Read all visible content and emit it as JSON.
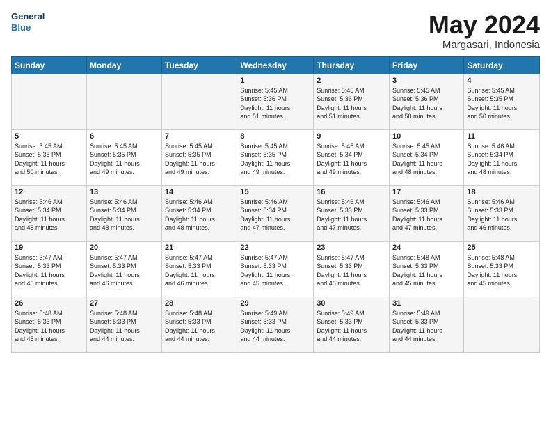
{
  "header": {
    "logo_line1": "General",
    "logo_line2": "Blue",
    "month": "May 2024",
    "location": "Margasari, Indonesia"
  },
  "weekdays": [
    "Sunday",
    "Monday",
    "Tuesday",
    "Wednesday",
    "Thursday",
    "Friday",
    "Saturday"
  ],
  "weeks": [
    [
      {
        "day": "",
        "info": ""
      },
      {
        "day": "",
        "info": ""
      },
      {
        "day": "",
        "info": ""
      },
      {
        "day": "1",
        "info": "Sunrise: 5:45 AM\nSunset: 5:36 PM\nDaylight: 11 hours\nand 51 minutes."
      },
      {
        "day": "2",
        "info": "Sunrise: 5:45 AM\nSunset: 5:36 PM\nDaylight: 11 hours\nand 51 minutes."
      },
      {
        "day": "3",
        "info": "Sunrise: 5:45 AM\nSunset: 5:36 PM\nDaylight: 11 hours\nand 50 minutes."
      },
      {
        "day": "4",
        "info": "Sunrise: 5:45 AM\nSunset: 5:35 PM\nDaylight: 11 hours\nand 50 minutes."
      }
    ],
    [
      {
        "day": "5",
        "info": "Sunrise: 5:45 AM\nSunset: 5:35 PM\nDaylight: 11 hours\nand 50 minutes."
      },
      {
        "day": "6",
        "info": "Sunrise: 5:45 AM\nSunset: 5:35 PM\nDaylight: 11 hours\nand 49 minutes."
      },
      {
        "day": "7",
        "info": "Sunrise: 5:45 AM\nSunset: 5:35 PM\nDaylight: 11 hours\nand 49 minutes."
      },
      {
        "day": "8",
        "info": "Sunrise: 5:45 AM\nSunset: 5:35 PM\nDaylight: 11 hours\nand 49 minutes."
      },
      {
        "day": "9",
        "info": "Sunrise: 5:45 AM\nSunset: 5:34 PM\nDaylight: 11 hours\nand 49 minutes."
      },
      {
        "day": "10",
        "info": "Sunrise: 5:45 AM\nSunset: 5:34 PM\nDaylight: 11 hours\nand 48 minutes."
      },
      {
        "day": "11",
        "info": "Sunrise: 5:46 AM\nSunset: 5:34 PM\nDaylight: 11 hours\nand 48 minutes."
      }
    ],
    [
      {
        "day": "12",
        "info": "Sunrise: 5:46 AM\nSunset: 5:34 PM\nDaylight: 11 hours\nand 48 minutes."
      },
      {
        "day": "13",
        "info": "Sunrise: 5:46 AM\nSunset: 5:34 PM\nDaylight: 11 hours\nand 48 minutes."
      },
      {
        "day": "14",
        "info": "Sunrise: 5:46 AM\nSunset: 5:34 PM\nDaylight: 11 hours\nand 48 minutes."
      },
      {
        "day": "15",
        "info": "Sunrise: 5:46 AM\nSunset: 5:34 PM\nDaylight: 11 hours\nand 47 minutes."
      },
      {
        "day": "16",
        "info": "Sunrise: 5:46 AM\nSunset: 5:33 PM\nDaylight: 11 hours\nand 47 minutes."
      },
      {
        "day": "17",
        "info": "Sunrise: 5:46 AM\nSunset: 5:33 PM\nDaylight: 11 hours\nand 47 minutes."
      },
      {
        "day": "18",
        "info": "Sunrise: 5:46 AM\nSunset: 5:33 PM\nDaylight: 11 hours\nand 46 minutes."
      }
    ],
    [
      {
        "day": "19",
        "info": "Sunrise: 5:47 AM\nSunset: 5:33 PM\nDaylight: 11 hours\nand 46 minutes."
      },
      {
        "day": "20",
        "info": "Sunrise: 5:47 AM\nSunset: 5:33 PM\nDaylight: 11 hours\nand 46 minutes."
      },
      {
        "day": "21",
        "info": "Sunrise: 5:47 AM\nSunset: 5:33 PM\nDaylight: 11 hours\nand 46 minutes."
      },
      {
        "day": "22",
        "info": "Sunrise: 5:47 AM\nSunset: 5:33 PM\nDaylight: 11 hours\nand 45 minutes."
      },
      {
        "day": "23",
        "info": "Sunrise: 5:47 AM\nSunset: 5:33 PM\nDaylight: 11 hours\nand 45 minutes."
      },
      {
        "day": "24",
        "info": "Sunrise: 5:48 AM\nSunset: 5:33 PM\nDaylight: 11 hours\nand 45 minutes."
      },
      {
        "day": "25",
        "info": "Sunrise: 5:48 AM\nSunset: 5:33 PM\nDaylight: 11 hours\nand 45 minutes."
      }
    ],
    [
      {
        "day": "26",
        "info": "Sunrise: 5:48 AM\nSunset: 5:33 PM\nDaylight: 11 hours\nand 45 minutes."
      },
      {
        "day": "27",
        "info": "Sunrise: 5:48 AM\nSunset: 5:33 PM\nDaylight: 11 hours\nand 44 minutes."
      },
      {
        "day": "28",
        "info": "Sunrise: 5:48 AM\nSunset: 5:33 PM\nDaylight: 11 hours\nand 44 minutes."
      },
      {
        "day": "29",
        "info": "Sunrise: 5:49 AM\nSunset: 5:33 PM\nDaylight: 11 hours\nand 44 minutes."
      },
      {
        "day": "30",
        "info": "Sunrise: 5:49 AM\nSunset: 5:33 PM\nDaylight: 11 hours\nand 44 minutes."
      },
      {
        "day": "31",
        "info": "Sunrise: 5:49 AM\nSunset: 5:33 PM\nDaylight: 11 hours\nand 44 minutes."
      },
      {
        "day": "",
        "info": ""
      }
    ]
  ]
}
